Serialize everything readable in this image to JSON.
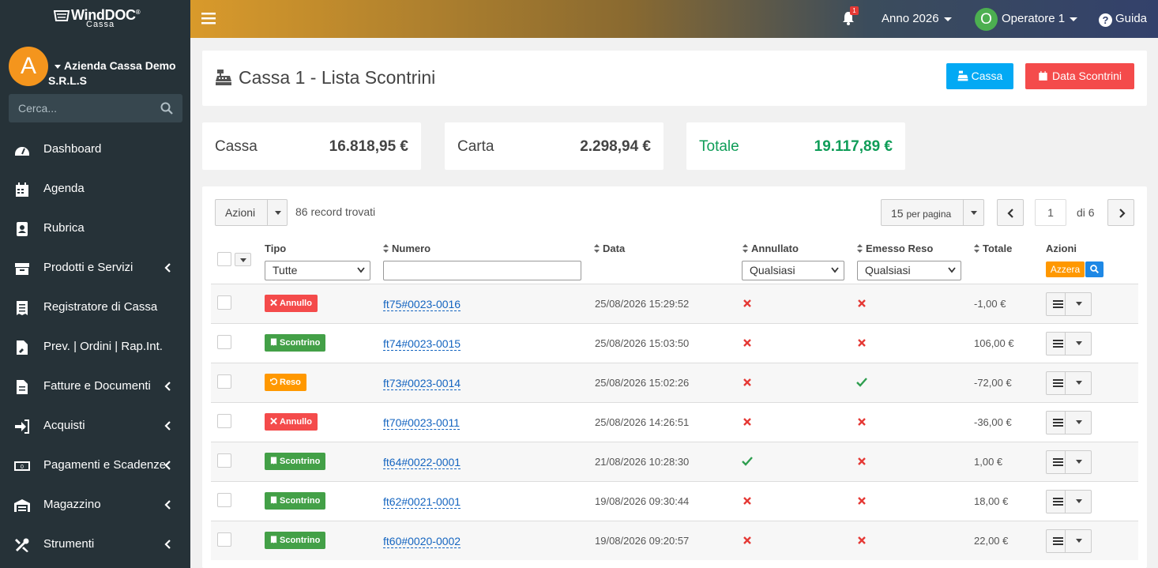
{
  "brand": {
    "name": "WindDOC",
    "registered": "®",
    "sub": "Cassa"
  },
  "sidebar": {
    "avatar_letter": "A",
    "company_line1": "Azienda Cassa Demo",
    "company_line2": "S.R.L.S",
    "search_placeholder": "Cerca...",
    "items": [
      {
        "label": "Dashboard",
        "icon": "dashboard-icon",
        "chevron": false
      },
      {
        "label": "Agenda",
        "icon": "calendar-icon",
        "chevron": false
      },
      {
        "label": "Rubrica",
        "icon": "address-book-icon",
        "chevron": false
      },
      {
        "label": "Prodotti e Servizi",
        "icon": "box-icon",
        "chevron": true
      },
      {
        "label": "Registratore di Cassa",
        "icon": "receipt-icon",
        "chevron": false
      },
      {
        "label": "Prev. | Ordini | Rap.Int.",
        "icon": "document-edit-icon",
        "chevron": false
      },
      {
        "label": "Fatture e Documenti",
        "icon": "file-icon",
        "chevron": true
      },
      {
        "label": "Acquisti",
        "icon": "sign-in-icon",
        "chevron": true
      },
      {
        "label": "Pagamenti e Scadenze",
        "icon": "money-icon",
        "chevron": true
      },
      {
        "label": "Magazzino",
        "icon": "warehouse-icon",
        "chevron": true
      },
      {
        "label": "Strumenti",
        "icon": "tools-icon",
        "chevron": true
      }
    ]
  },
  "topbar": {
    "notifications": "1",
    "year": "Anno 2026",
    "operator_initial": "O",
    "operator": "Operatore 1",
    "help": "Guida"
  },
  "header": {
    "title": "Cassa 1 - Lista Scontrini",
    "btn_cassa": "Cassa",
    "btn_data": "Data Scontrini",
    "colors": {
      "cassa": "#03a9f4",
      "data": "#f44b4b"
    }
  },
  "stats": [
    {
      "label": "Cassa",
      "value": "16.818,95 €",
      "color": "#444444"
    },
    {
      "label": "Carta",
      "value": "2.298,94 €",
      "color": "#444444"
    },
    {
      "label": "Totale",
      "value": "19.117,89 €",
      "color": "#0f9d58"
    }
  ],
  "list": {
    "actions_label": "Azioni",
    "records_found": "86 record trovati",
    "per_page_value": "15",
    "per_page_label": "per pagina",
    "page": "1",
    "of_pages": "di 6",
    "columns": {
      "tipo": "Tipo",
      "numero": "Numero",
      "data": "Data",
      "annullato": "Annullato",
      "emesso_reso": "Emesso Reso",
      "totale": "Totale",
      "azioni": "Azioni"
    },
    "filters": {
      "tipo": "Tutte",
      "annullato": "Qualsiasi",
      "emesso_reso": "Qualsiasi",
      "reset": "Azzera"
    },
    "rows": [
      {
        "type": "Annullo",
        "type_color": "#f44b4b",
        "numero": "ft75#0023-0016",
        "data": "25/08/2026 15:29:52",
        "annullato": false,
        "reso": false,
        "totale": "-1,00 €"
      },
      {
        "type": "Scontrino",
        "type_color": "#43a047",
        "numero": "ft74#0023-0015",
        "data": "25/08/2026 15:03:50",
        "annullato": false,
        "reso": false,
        "totale": "106,00 €"
      },
      {
        "type": "Reso",
        "type_color": "#ff9800",
        "numero": "ft73#0023-0014",
        "data": "25/08/2026 15:02:26",
        "annullato": false,
        "reso": true,
        "totale": "-72,00 €"
      },
      {
        "type": "Annullo",
        "type_color": "#f44b4b",
        "numero": "ft70#0023-0011",
        "data": "25/08/2026 14:26:51",
        "annullato": false,
        "reso": false,
        "totale": "-36,00 €"
      },
      {
        "type": "Scontrino",
        "type_color": "#43a047",
        "numero": "ft64#0022-0001",
        "data": "21/08/2026 10:28:30",
        "annullato": true,
        "reso": false,
        "totale": "1,00 €"
      },
      {
        "type": "Scontrino",
        "type_color": "#43a047",
        "numero": "ft62#0021-0001",
        "data": "19/08/2026 09:30:44",
        "annullato": false,
        "reso": false,
        "totale": "18,00 €"
      },
      {
        "type": "Scontrino",
        "type_color": "#43a047",
        "numero": "ft60#0020-0002",
        "data": "19/08/2026 09:20:57",
        "annullato": false,
        "reso": false,
        "totale": "22,00 €"
      }
    ]
  }
}
